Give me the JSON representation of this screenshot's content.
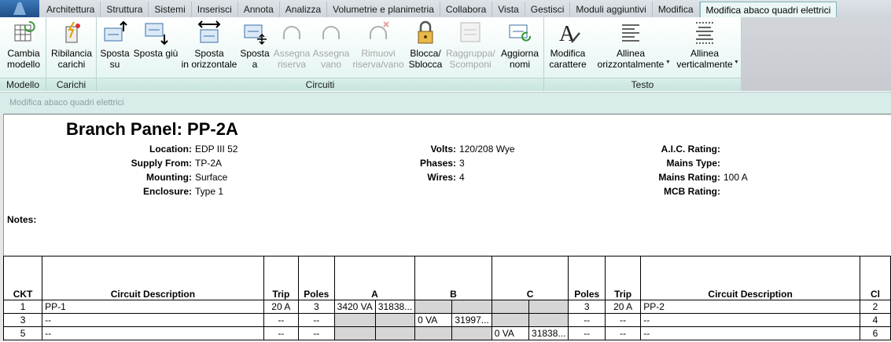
{
  "tabs": [
    "Architettura",
    "Struttura",
    "Sistemi",
    "Inserisci",
    "Annota",
    "Analizza",
    "Volumetrie e planimetria",
    "Collabora",
    "Vista",
    "Gestisci",
    "Moduli aggiuntivi",
    "Modifica",
    "Modifica abaco quadri elettrici"
  ],
  "active_tab": "Modifica abaco quadri elettrici",
  "ribbon": {
    "modello": {
      "label": "Modello",
      "cambia_modello": [
        "Cambia",
        "modello"
      ]
    },
    "carichi": {
      "label": "Carichi",
      "ribilancia": [
        "Ribilancia",
        "carichi"
      ]
    },
    "circuiti": {
      "label": "Circuiti",
      "sposta_su": [
        "Sposta",
        "su"
      ],
      "sposta_giu": [
        "Sposta giù",
        ""
      ],
      "sposta_orizz": [
        "Sposta",
        "in orizzontale"
      ],
      "sposta_a": [
        "Sposta",
        "a"
      ],
      "assegna_riserva": [
        "Assegna",
        "riserva"
      ],
      "assegna_vano": [
        "Assegna",
        "vano"
      ],
      "rimuovi": [
        "Rimuovi",
        "riserva/vano"
      ],
      "blocca": [
        "Blocca/",
        "Sblocca"
      ],
      "raggruppa": [
        "Raggruppa/",
        "Scomponi"
      ],
      "aggiorna": [
        "Aggiorna",
        "nomi"
      ]
    },
    "testo": {
      "label": "Testo",
      "modifica_caratt": [
        "Modifica",
        "carattere"
      ],
      "allinea_orizz": [
        "Allinea",
        "orizzontalmente"
      ],
      "allinea_vert": [
        "Allinea",
        "verticalmente"
      ]
    }
  },
  "context_label": "Modifica abaco quadri elettrici",
  "panel": {
    "title": "Branch Panel: PP-2A",
    "left": [
      {
        "label": "Location:",
        "value": "EDP III 52"
      },
      {
        "label": "Supply From:",
        "value": "TP-2A"
      },
      {
        "label": "Mounting:",
        "value": "Surface"
      },
      {
        "label": "Enclosure:",
        "value": "Type 1"
      }
    ],
    "middle": [
      {
        "label": "Volts:",
        "value": "120/208 Wye"
      },
      {
        "label": "Phases:",
        "value": "3"
      },
      {
        "label": "Wires:",
        "value": "4"
      }
    ],
    "right": [
      {
        "label": "A.I.C. Rating:",
        "value": ""
      },
      {
        "label": "Mains Type:",
        "value": ""
      },
      {
        "label": "Mains Rating:",
        "value": "100 A"
      },
      {
        "label": "MCB Rating:",
        "value": ""
      }
    ],
    "notes_label": "Notes:"
  },
  "table": {
    "headers": [
      "CKT",
      "Circuit Description",
      "Trip",
      "Poles",
      "A",
      "B",
      "C",
      "Poles",
      "Trip",
      "Circuit Description",
      "Cl"
    ],
    "rows": [
      [
        "1",
        "PP-1",
        "20 A",
        "3",
        "3420 VA",
        "31838...",
        "",
        "",
        "",
        "",
        "3",
        "20 A",
        "PP-2",
        "2"
      ],
      [
        "3",
        "--",
        "--",
        "--",
        "",
        "",
        "0 VA",
        "31997...",
        "",
        "",
        "--",
        "--",
        "--",
        "4"
      ],
      [
        "5",
        "--",
        "--",
        "--",
        "",
        "",
        "",
        "",
        "0 VA",
        "31838...",
        "--",
        "--",
        "--",
        "6"
      ]
    ]
  }
}
